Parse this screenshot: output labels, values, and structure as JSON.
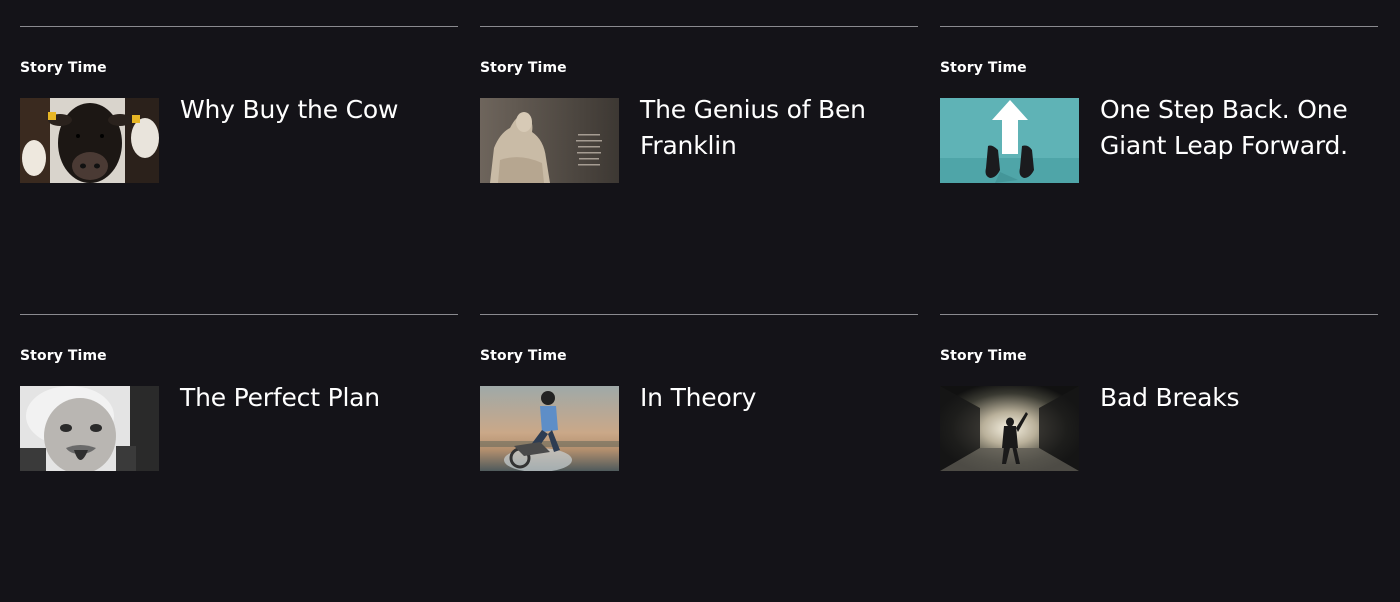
{
  "posts": [
    {
      "category": "Story Time",
      "title": "Why Buy the Cow",
      "image_icon": "cow-photo"
    },
    {
      "category": "Story Time",
      "title": "The Genius of Ben Franklin",
      "image_icon": "franklin-statue-photo"
    },
    {
      "category": "Story Time",
      "title": "One Step Back. One Giant Leap Forward.",
      "image_icon": "arrow-feet-photo"
    },
    {
      "category": "Story Time",
      "title": "The Perfect Plan",
      "image_icon": "einstein-photo"
    },
    {
      "category": "Story Time",
      "title": "In Theory",
      "image_icon": "motocross-photo"
    },
    {
      "category": "Story Time",
      "title": "Bad Breaks",
      "image_icon": "tunnel-photo"
    }
  ],
  "colors": {
    "background": "#141318",
    "divider": "#8a8a8f",
    "text": "#ffffff"
  }
}
